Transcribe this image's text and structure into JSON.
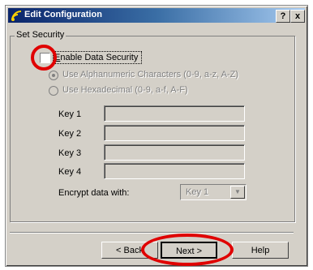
{
  "window": {
    "title": "Edit Configuration",
    "help_button": "?",
    "close_button": "x"
  },
  "group": {
    "label": "Set Security"
  },
  "security": {
    "enable_label": "Enable Data Security",
    "enabled": false
  },
  "radios": [
    {
      "label": "Use Alphanumeric Characters (0-9, a-z, A-Z)",
      "selected": true
    },
    {
      "label": "Use Hexadecimal (0-9, a-f, A-F)",
      "selected": false
    }
  ],
  "keys": [
    {
      "label": "Key 1",
      "value": ""
    },
    {
      "label": "Key 2",
      "value": ""
    },
    {
      "label": "Key 3",
      "value": ""
    },
    {
      "label": "Key 4",
      "value": ""
    }
  ],
  "encrypt": {
    "label": "Encrypt data with:",
    "selected": "Key 1"
  },
  "buttons": {
    "back": "< Back",
    "next": "Next >",
    "help": "Help"
  },
  "colors": {
    "annotation_red": "#e00000",
    "title_bar": "#0a246a"
  }
}
